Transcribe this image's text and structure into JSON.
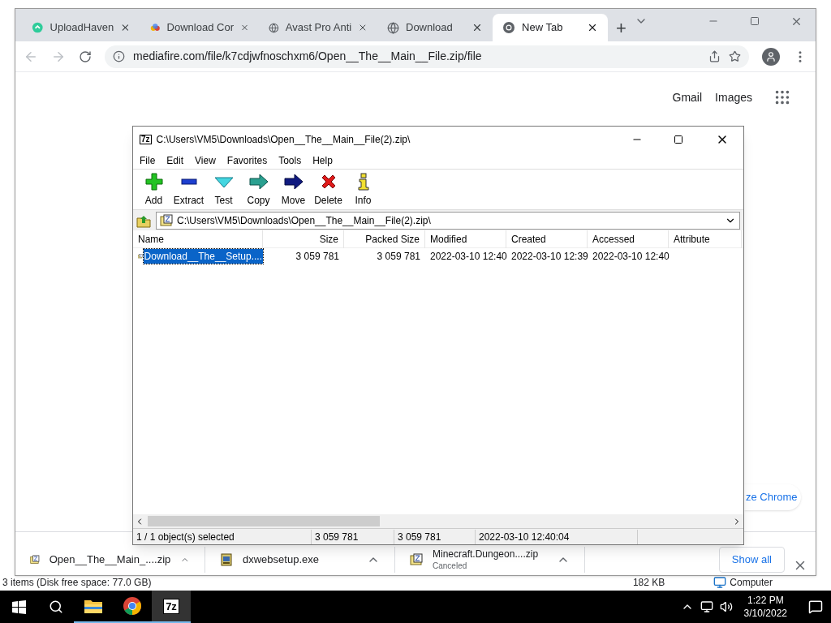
{
  "browser": {
    "tabs": [
      {
        "title": "UploadHaven",
        "kind": "cloud",
        "selected": false
      },
      {
        "title": "Download Cor",
        "kind": "wheel",
        "selected": false
      },
      {
        "title": "Avast Pro Anti",
        "kind": "globe",
        "selected": false
      },
      {
        "title": "Download",
        "kind": "globe",
        "selected": false
      },
      {
        "title": "New Tab",
        "kind": "chrome",
        "selected": true
      }
    ],
    "new_tab_button": "+",
    "url": "mediafire.com/file/k7cdjwfnoschxm6/Open__The__Main__File.zip/file",
    "links": [
      "Gmail",
      "Images"
    ],
    "customize_button": "ze Chrome",
    "downloads": [
      {
        "name": "Open__The__Main_....zip",
        "kind": "archive"
      },
      {
        "name": "dxwebsetup.exe",
        "kind": "installer"
      },
      {
        "name": "Minecraft.Dungeon....zip",
        "status": "Canceled",
        "kind": "archive"
      }
    ],
    "show_all": "Show all"
  },
  "archiver": {
    "title": "C:\\Users\\VM5\\Downloads\\Open__The__Main__File(2).zip\\",
    "menu": [
      "File",
      "Edit",
      "View",
      "Favorites",
      "Tools",
      "Help"
    ],
    "toolbar": [
      {
        "label": "Add",
        "kind": "add"
      },
      {
        "label": "Extract",
        "kind": "extract"
      },
      {
        "label": "Test",
        "kind": "test"
      },
      {
        "label": "Copy",
        "kind": "copy"
      },
      {
        "label": "Move",
        "kind": "move"
      },
      {
        "label": "Delete",
        "kind": "delete"
      },
      {
        "label": "Info",
        "kind": "info"
      }
    ],
    "path": "C:\\Users\\VM5\\Downloads\\Open__The__Main__File(2).zip\\",
    "columns": [
      "Name",
      "Size",
      "Packed Size",
      "Modified",
      "Created",
      "Accessed",
      "Attribute"
    ],
    "rows": [
      {
        "selected": true,
        "cells": [
          "Download__The__Setup....",
          "3 059 781",
          "3 059 781",
          "2022-03-10 12:40",
          "2022-03-10 12:39",
          "2022-03-10 12:40",
          ""
        ]
      }
    ],
    "status": [
      "1 / 1 object(s) selected",
      "3 059 781",
      "3 059 781",
      "2022-03-10 12:40:04"
    ]
  },
  "explorer_status": {
    "items": "3 items (Disk free space: 77.0 GB)",
    "size": "182 KB",
    "location": "Computer"
  },
  "taskbar": {
    "apps": [
      {
        "kind": "folder",
        "selected": false
      },
      {
        "kind": "chrome",
        "selected": false
      },
      {
        "kind": "7z",
        "selected": true,
        "label": "7z"
      }
    ],
    "time": "1:22 PM",
    "date": "3/10/2022"
  }
}
